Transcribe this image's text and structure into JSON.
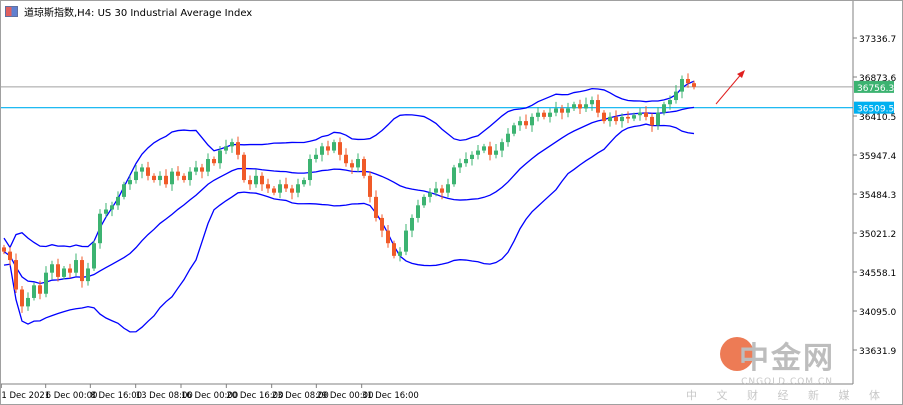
{
  "title": "道琼斯指数,H4:  US 30 Industrial Average Index",
  "colors": {
    "bull": "#3cb371",
    "bear": "#f05a28",
    "band": "#0000ff",
    "cyan": "#00b0f0",
    "grid_line": "#a0a0a0",
    "current": "#3cb371",
    "arrow": "#e02020"
  },
  "watermark": {
    "brand": "中金网",
    "domain": "CNGOLD.COM.CN",
    "tagline": "中 文 财 经 新 媒 体"
  },
  "chart_data": {
    "type": "candlestick",
    "symbol": "US 30",
    "timeframe": "H4",
    "y_ticks": [
      37336.7,
      36873.6,
      36410.5,
      35947.4,
      35484.3,
      35021.2,
      34558.1,
      34095.0,
      33631.9
    ],
    "y_tick_labels": [
      "37336.7",
      "36873.6",
      "36410.5",
      "35947.4",
      "35484.3",
      "35021.2",
      "34558.1",
      "34095.0",
      "33631.9"
    ],
    "x_tick_labels": [
      "1 Dec 2021",
      "6 Dec 00:00",
      "8 Dec 16:00",
      "13 Dec 08:00",
      "16 Dec 00:00",
      "20 Dec 16:00",
      "23 Dec 08:00",
      "29 Dec 00:00",
      "31 Dec 16:00"
    ],
    "current_price": 36756.3,
    "current_price_label": "36756.3",
    "level_line": 36509.5,
    "level_line_label": "36509.5",
    "indicator": "Bollinger Bands (20, 2)",
    "closes": [
      34800,
      34700,
      34350,
      34150,
      34250,
      34400,
      34300,
      34550,
      34650,
      34500,
      34600,
      34550,
      34700,
      34450,
      34600,
      34900,
      35250,
      35300,
      35350,
      35450,
      35600,
      35650,
      35750,
      35800,
      35700,
      35650,
      35700,
      35600,
      35750,
      35700,
      35650,
      35750,
      35800,
      35750,
      35900,
      35850,
      36000,
      36050,
      36100,
      35950,
      35650,
      35600,
      35700,
      35600,
      35550,
      35500,
      35600,
      35550,
      35500,
      35600,
      35650,
      35900,
      35950,
      36050,
      36000,
      36100,
      35950,
      35850,
      35800,
      35900,
      35700,
      35450,
      35200,
      35050,
      34900,
      34750,
      34800,
      35050,
      35200,
      35350,
      35450,
      35500,
      35550,
      35500,
      35600,
      35800,
      35850,
      35900,
      35950,
      36000,
      36050,
      35950,
      36000,
      36100,
      36200,
      36300,
      36350,
      36300,
      36400,
      36450,
      36400,
      36450,
      36500,
      36450,
      36500,
      36550,
      36500,
      36550,
      36600,
      36450,
      36350,
      36400,
      36350,
      36400,
      36380,
      36420,
      36450,
      36400,
      36300,
      36450,
      36550,
      36600,
      36700,
      36850,
      36800,
      36756.3
    ]
  }
}
